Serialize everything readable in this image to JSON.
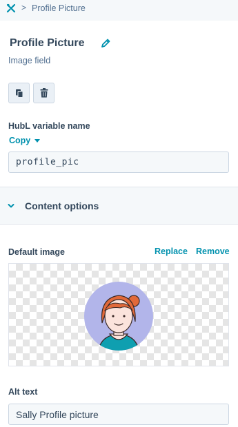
{
  "breadcrumb": {
    "icon": "tools-icon",
    "separator": ">",
    "current": "Profile Picture"
  },
  "header": {
    "title": "Profile Picture",
    "subtitle": "Image field",
    "edit_icon": "pencil-icon"
  },
  "actions": [
    {
      "name": "copy-field-button",
      "icon": "clone-icon"
    },
    {
      "name": "delete-field-button",
      "icon": "trash-icon"
    }
  ],
  "hubl": {
    "label": "HubL variable name",
    "copy_label": "Copy",
    "value": "profile_pic"
  },
  "content_options": {
    "label": "Content options",
    "expanded": false
  },
  "default_image": {
    "label": "Default image",
    "replace_label": "Replace",
    "remove_label": "Remove"
  },
  "alt_text": {
    "label": "Alt text",
    "value": "Sally Profile picture"
  },
  "colors": {
    "accent": "#0091ae",
    "text": "#33475b",
    "muted": "#516f90",
    "panel": "#f5f8fa",
    "border": "#cbd6e2",
    "avatar_bg": "#b2b5ea",
    "hair": "#e1693a",
    "shirt": "#0f9fb0"
  }
}
